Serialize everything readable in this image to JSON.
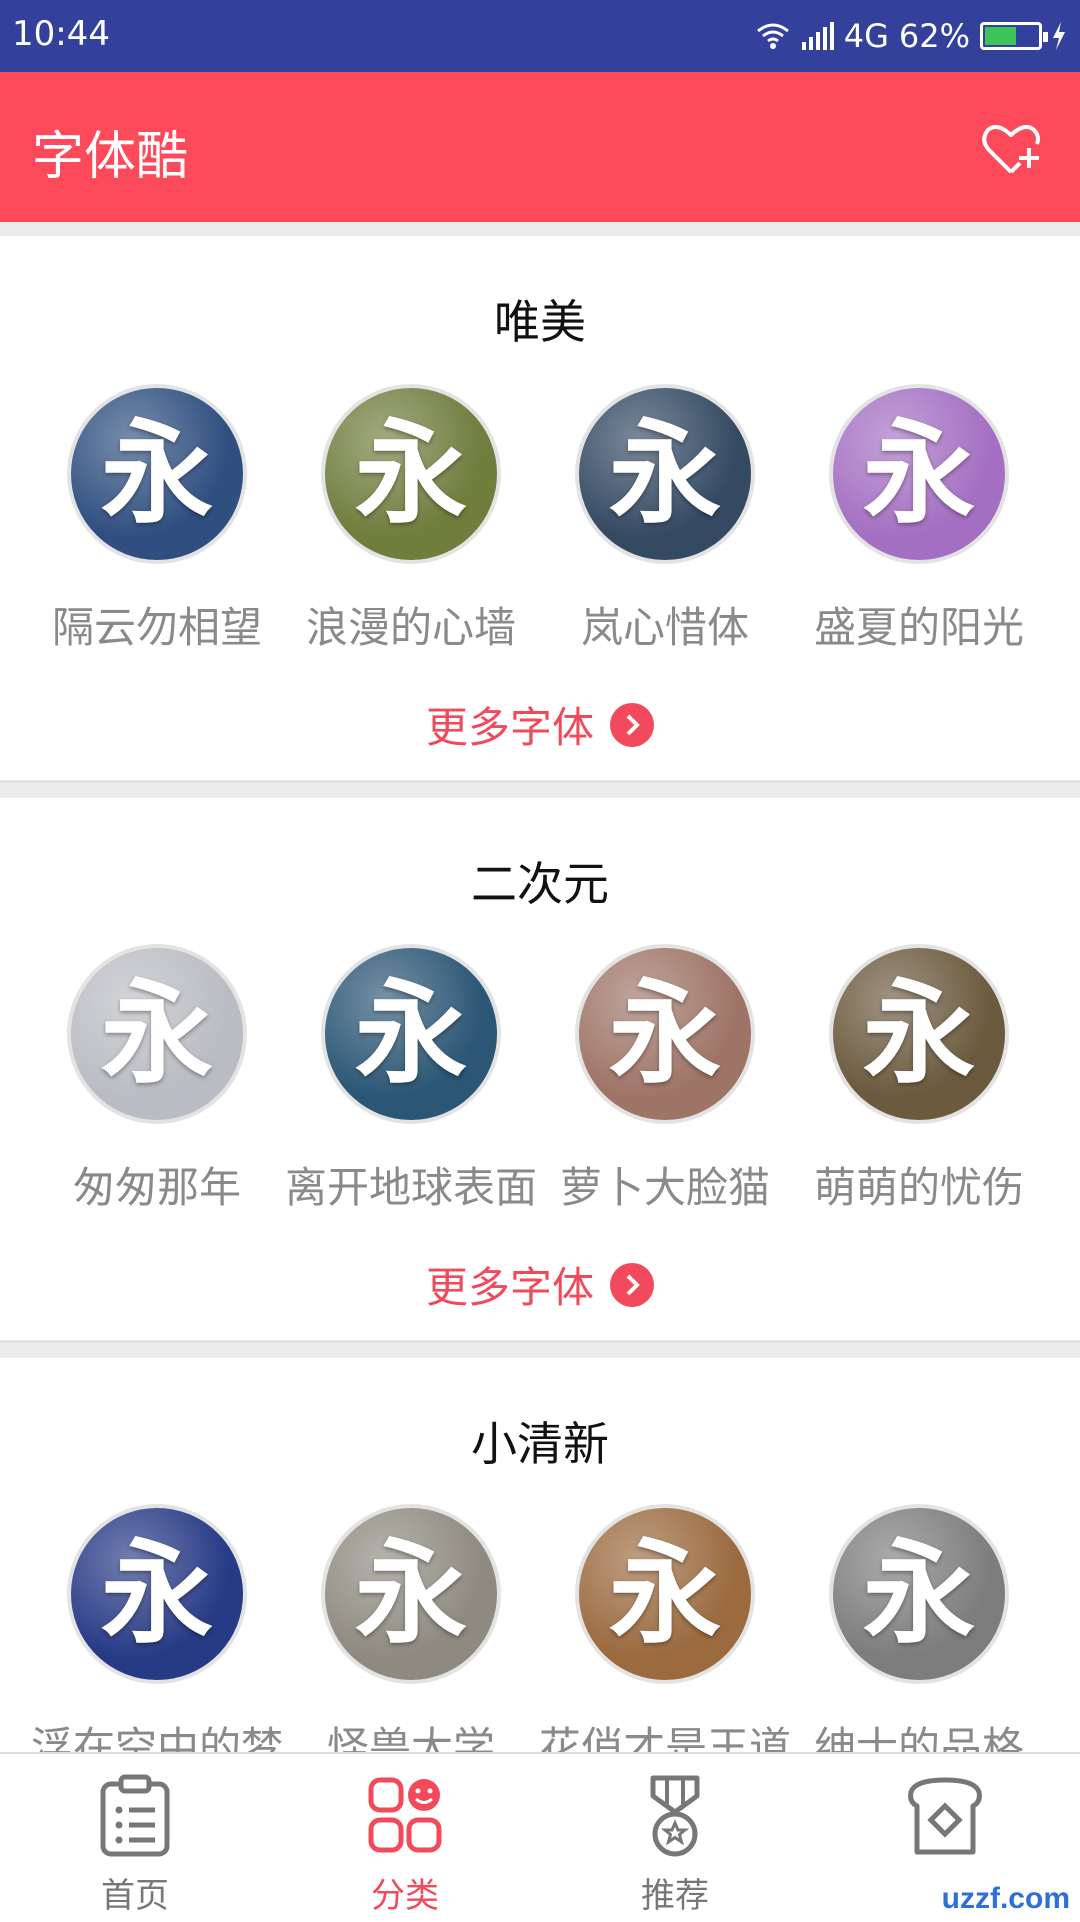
{
  "status_bar": {
    "time": "10:44",
    "network": "4G",
    "battery": "62%",
    "battery_level": 0.62
  },
  "app_bar": {
    "title": "字体酷"
  },
  "more_label": "更多字体",
  "sections": [
    {
      "title": "唯美",
      "items": [
        {
          "label": "隔云勿相望",
          "glyph": "永",
          "bg": "#2f4f80"
        },
        {
          "label": "浪漫的心墙",
          "glyph": "永",
          "bg": "#6f7d3d"
        },
        {
          "label": "岚心惜体",
          "glyph": "永",
          "bg": "#344a63"
        },
        {
          "label": "盛夏的阳光",
          "glyph": "永",
          "bg": "#a46fc2"
        }
      ]
    },
    {
      "title": "二次元",
      "items": [
        {
          "label": "匆匆那年",
          "glyph": "永",
          "bg": "#b9bcc2"
        },
        {
          "label": "离开地球表面",
          "glyph": "永",
          "bg": "#2b5675"
        },
        {
          "label": "萝卜大脸猫",
          "glyph": "永",
          "bg": "#9e7466"
        },
        {
          "label": "萌萌的忧伤",
          "glyph": "永",
          "bg": "#6b5a3e"
        }
      ]
    },
    {
      "title": "小清新",
      "items": [
        {
          "label": "浮在空中的梦",
          "glyph": "永",
          "bg": "#273a85"
        },
        {
          "label": "怪兽大学",
          "glyph": "永",
          "bg": "#8e8a80"
        },
        {
          "label": "花俏才是王道",
          "glyph": "永",
          "bg": "#9b6a3f"
        },
        {
          "label": "绅士的品格",
          "glyph": "永",
          "bg": "#7d7d7d"
        }
      ]
    }
  ],
  "bottom_nav": [
    {
      "label": "首页",
      "icon": "clipboard-list-icon",
      "active": false
    },
    {
      "label": "分类",
      "icon": "category-grid-icon",
      "active": true
    },
    {
      "label": "推荐",
      "icon": "medal-icon",
      "active": false
    },
    {
      "label": "",
      "icon": "bread-icon",
      "active": false
    }
  ],
  "watermark": "uzzf.com",
  "colors": {
    "status_bar": "#33419c",
    "accent": "#fc4a5b",
    "label": "#8a8a8a"
  }
}
